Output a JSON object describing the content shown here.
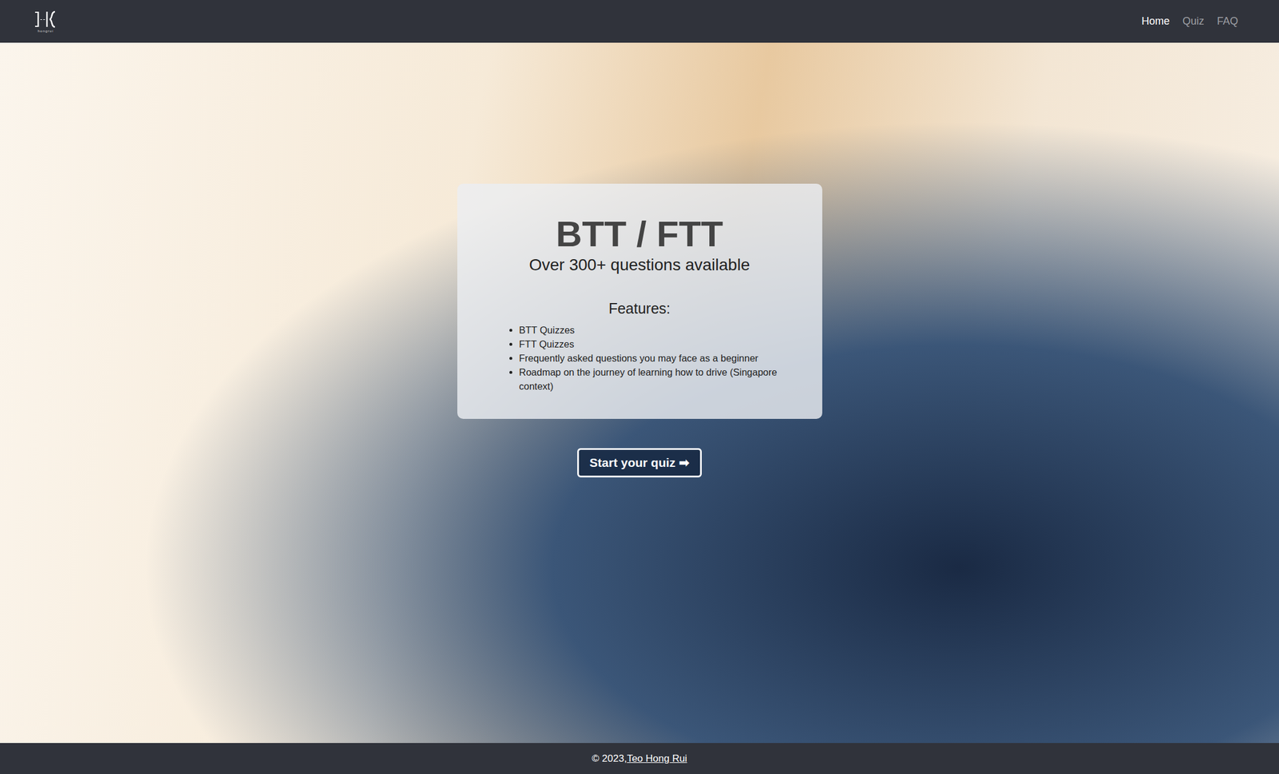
{
  "navbar": {
    "logo": {
      "caption": "hongrui"
    },
    "links": [
      {
        "label": "Home",
        "selected": true
      },
      {
        "label": "Quiz",
        "selected": false
      },
      {
        "label": "FAQ",
        "selected": false
      }
    ]
  },
  "hero": {
    "title": "BTT / FTT",
    "subtitle": "Over 300+ questions available",
    "features_heading": "Features:",
    "features": [
      "BTT Quizzes",
      "FTT Quizzes",
      "Frequently asked questions you may face as a beginner",
      "Roadmap on the journey of learning how to drive (Singapore context)"
    ],
    "button": "Start your quiz ➡"
  },
  "footer": {
    "prefix": "© 2023, ",
    "author": "Teo Hong Rui"
  }
}
